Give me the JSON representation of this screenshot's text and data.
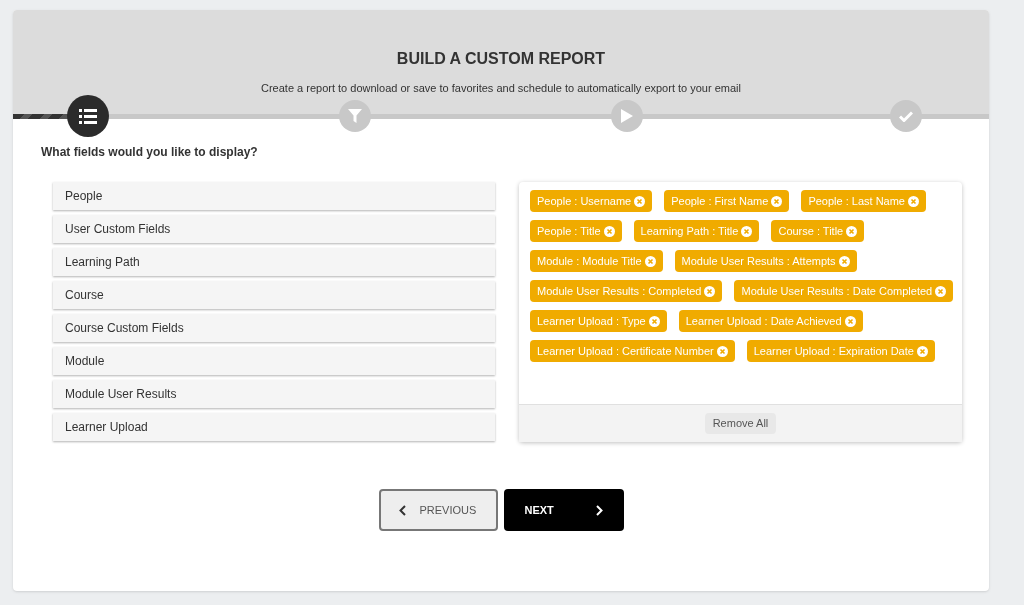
{
  "header": {
    "title": "BUILD A CUSTOM REPORT",
    "subtitle": "Create a report to download or save to favorites and schedule to automatically export to your email"
  },
  "steps": [
    {
      "kind": "list",
      "selected": true
    },
    {
      "kind": "filter",
      "selected": false
    },
    {
      "kind": "play",
      "selected": false
    },
    {
      "kind": "check",
      "selected": false
    }
  ],
  "question": "What fields would you like to display?",
  "categories": [
    "People",
    "User Custom Fields",
    "Learning Path",
    "Course",
    "Course Custom Fields",
    "Module",
    "Module User Results",
    "Learner Upload"
  ],
  "selected_fields": [
    "People : Username",
    "People : First Name",
    "People : Last Name",
    "People : Title",
    "Learning Path : Title",
    "Course : Title",
    "Module : Module Title",
    "Module User Results : Attempts",
    "Module User Results : Completed",
    "Module User Results : Date Completed",
    "Learner Upload : Type",
    "Learner Upload : Date Achieved",
    "Learner Upload : Certificate Number",
    "Learner Upload : Expiration Date"
  ],
  "remove_all": "Remove All",
  "buttons": {
    "previous": "PREVIOUS",
    "next": "NEXT"
  }
}
